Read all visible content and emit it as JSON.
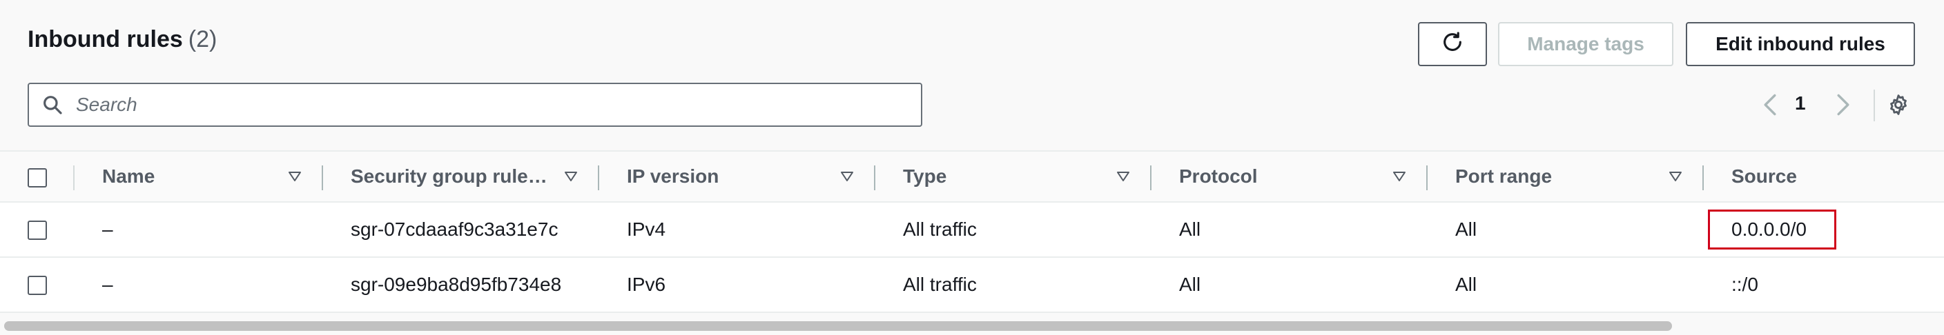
{
  "header": {
    "title": "Inbound rules",
    "count": "(2)"
  },
  "toolbar": {
    "refresh_icon": "refresh-icon",
    "manage_tags_label": "Manage tags",
    "edit_rules_label": "Edit inbound rules"
  },
  "search": {
    "placeholder": "Search",
    "value": ""
  },
  "pagination": {
    "current_page": "1"
  },
  "columns": [
    "Name",
    "Security group rule…",
    "IP version",
    "Type",
    "Protocol",
    "Port range",
    "Source"
  ],
  "rows": [
    {
      "name": "–",
      "rule_id": "sgr-07cdaaaf9c3a31e7c",
      "ip_version": "IPv4",
      "type": "All traffic",
      "protocol": "All",
      "port_range": "All",
      "source": "0.0.0.0/0"
    },
    {
      "name": "–",
      "rule_id": "sgr-09e9ba8d95fb734e8",
      "ip_version": "IPv6",
      "type": "All traffic",
      "protocol": "All",
      "port_range": "All",
      "source": "::/0"
    }
  ],
  "colors": {
    "highlight": "#d0021b",
    "text": "#16191f",
    "muted": "#545b64",
    "disabled": "#aab7b8"
  }
}
